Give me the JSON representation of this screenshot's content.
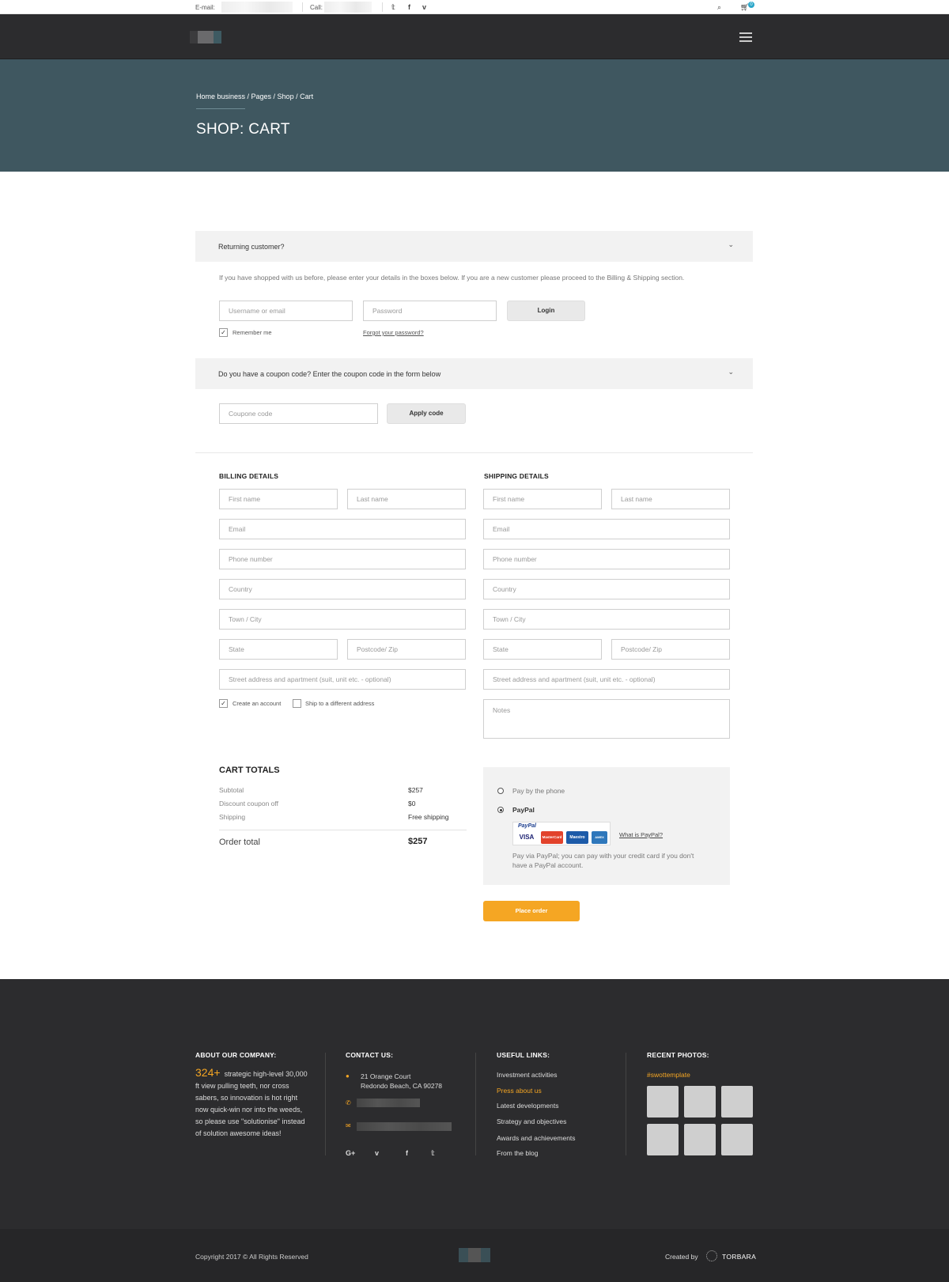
{
  "topbar": {
    "email_label": "E-mail:",
    "call_label": "Call:",
    "social": [
      "twitter-icon",
      "facebook-icon",
      "vimeo-icon"
    ],
    "cart_count": "0"
  },
  "hero": {
    "breadcrumb": "Home business / Pages / Shop / Cart",
    "title": "SHOP: CART"
  },
  "returning": {
    "bar_title": "Returning customer?",
    "description": "If you have shopped with us before, please enter your details in the boxes below. If you are a new customer please proceed to the Billing & Shipping section.",
    "username_placeholder": "Username or email",
    "password_placeholder": "Password",
    "login_label": "Login",
    "remember_label": "Remember me",
    "forgot_label": "Forgot your password?"
  },
  "coupon": {
    "bar_title": "Do you have a coupon code? Enter the coupon code in the form below",
    "placeholder": "Coupone code",
    "apply_label": "Apply code"
  },
  "billing": {
    "title": "BILLING DETAILS",
    "first_name": "First name",
    "last_name": "Last name",
    "email": "Email",
    "phone": "Phone number",
    "country": "Country",
    "town": "Town / City",
    "state": "State",
    "postcode": "Postcode/ Zip",
    "street": "Street address and apartment (suit, unit etc. - optional)",
    "create_account": "Create an account",
    "ship_different": "Ship to a different address"
  },
  "shipping": {
    "title": "SHIPPING DETAILS",
    "first_name": "First name",
    "last_name": "Last name",
    "email": "Email",
    "phone": "Phone number",
    "country": "Country",
    "town": "Town / City",
    "state": "State",
    "postcode": "Postcode/ Zip",
    "street": "Street address and apartment (suit, unit etc. - optional)",
    "notes": "Notes"
  },
  "cart_totals": {
    "title": "CART TOTALS",
    "rows": [
      {
        "label": "Subtotal",
        "value": "$257"
      },
      {
        "label": "Discount coupon off",
        "value": "$0"
      },
      {
        "label": "Shipping",
        "value": "Free shipping"
      }
    ],
    "order_total_label": "Order total",
    "order_total_value": "$257"
  },
  "payment": {
    "option_phone": "Pay by the phone",
    "option_paypal": "PayPal",
    "paypal_brand": "PayPal",
    "cards": [
      "VISA",
      "MasterCard",
      "Maestro",
      "AMEX"
    ],
    "what_is": "What is PayPal?",
    "note": "Pay via PayPal; you can pay with your credit card if you don't have a PayPal account.",
    "place_order": "Place order"
  },
  "footer": {
    "about_title": "ABOUT OUR COMPANY:",
    "about_big": "324+",
    "about_text": "strategic high-level 30,000 ft view pulling teeth, nor cross sabers, so innovation is hot right now quick-win nor into the weeds, so please use \"solutionise\" instead of solution awesome ideas!",
    "contact_title": "CONTACT US:",
    "address_line1": "21 Orange Court",
    "address_line2": "Redondo Beach, CA 90278",
    "contact_social": [
      "google-plus-icon",
      "vimeo-icon",
      "facebook-icon",
      "twitter-icon"
    ],
    "links_title": "USEFUL LINKS:",
    "links": [
      "Investment activities",
      "Press about us",
      "Latest developments",
      "Strategy and objectives",
      "Awards and achievements",
      "From the blog"
    ],
    "photos_title": "RECENT PHOTOS:",
    "photos_tag": "#swottemplate",
    "copyright": "Copyright 2017 © All Rights Reserved",
    "created_by": "Created by",
    "brand": "TORBARA"
  },
  "colors": {
    "accent": "#f5a623",
    "hero_bg": "#3f5760",
    "dark": "#2c2c2e"
  }
}
